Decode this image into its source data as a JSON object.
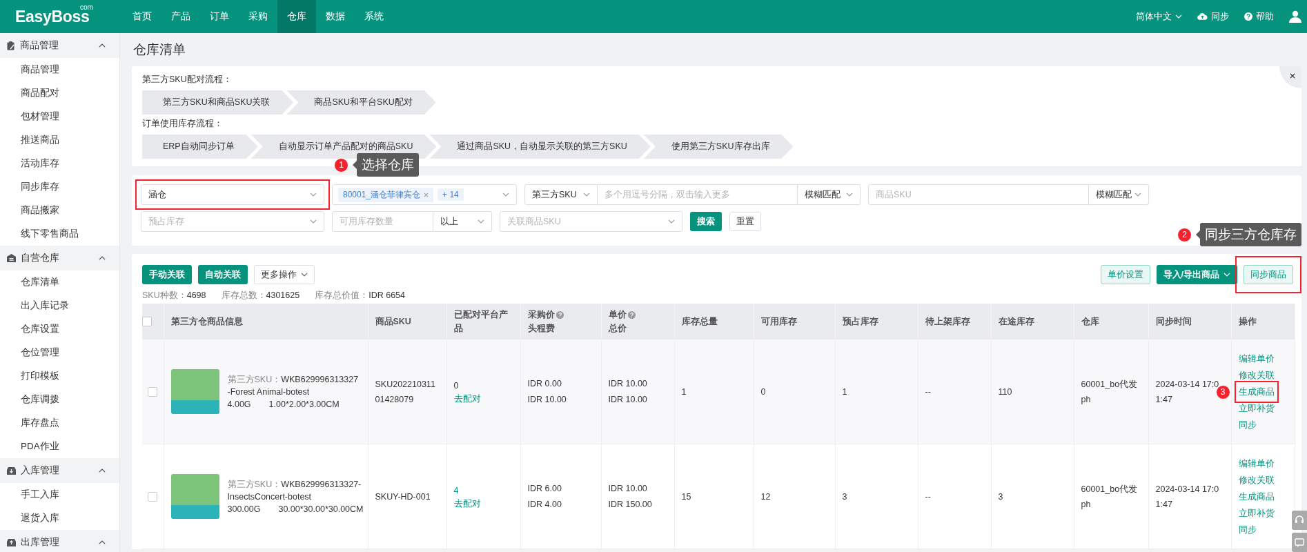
{
  "topbar": {
    "logo": "EasyBoss",
    "logo_suffix": "com",
    "nav": [
      {
        "label": "首页",
        "selected": false
      },
      {
        "label": "产品",
        "selected": false
      },
      {
        "label": "订单",
        "selected": false
      },
      {
        "label": "采购",
        "selected": false
      },
      {
        "label": "仓库",
        "selected": true
      },
      {
        "label": "数据",
        "selected": false
      },
      {
        "label": "系统",
        "selected": false
      }
    ],
    "language": "简体中文",
    "sync": "同步",
    "help": "帮助"
  },
  "sidebar": {
    "groups": [
      {
        "title": "商品管理",
        "kind": "goods",
        "expanded": true,
        "items": [
          "商品管理",
          "商品配对",
          "包材管理",
          "推送商品",
          "活动库存",
          "同步库存",
          "商品搬家",
          "线下零售商品"
        ]
      },
      {
        "title": "自营仓库",
        "kind": "warehouse",
        "expanded": true,
        "items": [
          "仓库清单",
          "出入库记录",
          "仓库设置",
          "仓位管理",
          "打印模板",
          "仓库调拨",
          "库存盘点",
          "PDA作业"
        ]
      },
      {
        "title": "入库管理",
        "kind": "inbound",
        "expanded": true,
        "items": [
          "手工入库",
          "退货入库"
        ]
      },
      {
        "title": "出库管理",
        "kind": "outbound",
        "expanded": true
      }
    ]
  },
  "page_title": "仓库清单",
  "flow": {
    "sections": [
      {
        "label": "第三方SKU配对流程：",
        "steps": [
          "第三方SKU和商品SKU关联",
          "商品SKU和平台SKU配对"
        ]
      },
      {
        "label": "订单使用库存流程：",
        "steps": [
          "ERP自动同步订单",
          "自动显示订单产品配对的商品SKU",
          "通过商品SKU，自动显示关联的第三方SKU",
          "使用第三方SKU库存出库"
        ]
      }
    ]
  },
  "filters": {
    "warehouse": {
      "value": "涵仓",
      "highlighted": true,
      "annotation": {
        "number": "1",
        "text": "选择仓库"
      }
    },
    "warehouse_tags": {
      "tags": [
        "80001_涵仓菲律宾仓"
      ],
      "more": "+ 14"
    },
    "sku_type": "第三方SKU",
    "sku_input": {
      "placeholder": "多个用逗号分隔，双击输入更多"
    },
    "sku_match": "模糊匹配",
    "product_sku": {
      "placeholder": "商品SKU"
    },
    "product_match": "模糊匹配",
    "reserved": {
      "placeholder": "预占库存"
    },
    "available_qty": {
      "placeholder": "可用库存数量"
    },
    "qty_compare": "以上",
    "linked_sku": {
      "placeholder": "关联商品SKU"
    },
    "search": "搜索",
    "reset": "重置"
  },
  "toolbar": {
    "left": [
      {
        "label": "手动关联",
        "kind": "primary",
        "highlighted": false
      },
      {
        "label": "自动关联",
        "kind": "primary",
        "highlighted": false
      },
      {
        "label": "更多操作",
        "kind": "dropdown",
        "highlighted": false
      }
    ],
    "right": [
      {
        "label": "单价设置",
        "kind": "light",
        "highlighted": false
      },
      {
        "label": "导入/导出商品",
        "kind": "primary-dropdown",
        "highlighted": false
      },
      {
        "label": "同步商品",
        "kind": "light",
        "highlighted": true,
        "annotation": {
          "number": "2",
          "text": "同步三方仓库存"
        }
      }
    ]
  },
  "stats": [
    {
      "label": "SKU种数：",
      "value": "4698"
    },
    {
      "label": "库存总数：",
      "value": "4301625"
    },
    {
      "label": "库存总价值：",
      "value": "IDR 6654"
    }
  ],
  "table": {
    "all_checked": false,
    "columns": [
      {
        "lines": [
          "第三方仓商品信息"
        ],
        "help": false
      },
      {
        "lines": [
          "商品SKU"
        ],
        "help": false
      },
      {
        "lines": [
          "已配对平台产品"
        ],
        "help": false
      },
      {
        "lines": [
          "采购价",
          "头程费"
        ],
        "help": true
      },
      {
        "lines": [
          "单价",
          "总价"
        ],
        "help": true
      },
      {
        "lines": [
          "库存总量"
        ],
        "help": false
      },
      {
        "lines": [
          "可用库存"
        ],
        "help": false
      },
      {
        "lines": [
          "预占库存"
        ],
        "help": false
      },
      {
        "lines": [
          "待上架库存"
        ],
        "help": false
      },
      {
        "lines": [
          "在途库存"
        ],
        "help": false
      },
      {
        "lines": [
          "仓库"
        ],
        "help": false
      },
      {
        "lines": [
          "同步时间"
        ],
        "help": false
      },
      {
        "lines": [
          "操作"
        ],
        "help": false
      }
    ],
    "rows": [
      {
        "checked": false,
        "sku_label": "第三方SKU：",
        "sku": "WKB629996313327-Forest Animal-botest",
        "weight": "4.00G",
        "size": "1.00*2.00*3.00CM",
        "product_sku": "SKU20221031101428079",
        "matched_count": "0",
        "has_matches": false,
        "match_link": "去配对",
        "purchase_price": "IDR 0.00",
        "first_leg_fee": "IDR 10.00",
        "unit_price": "IDR 10.00",
        "total_price": "IDR 10.00",
        "total_stock": "1",
        "available": "0",
        "reserved": "1",
        "pending_shelf": "--",
        "in_transit": "110",
        "warehouse": "60001_bo代发ph",
        "sync_time": "2024-03-14 17:01:47",
        "actions": [
          {
            "label": "编辑单价",
            "highlighted": false
          },
          {
            "label": "修改关联",
            "highlighted": false
          },
          {
            "label": "生成商品",
            "highlighted": true,
            "annotation": {
              "number": "3"
            }
          },
          {
            "label": "立即补货",
            "highlighted": false
          },
          {
            "label": "同步",
            "highlighted": false
          }
        ]
      },
      {
        "checked": false,
        "sku_label": "第三方SKU：",
        "sku": "WKB629996313327-InsectsConcert-botest",
        "weight": "300.00G",
        "size": "30.00*30.00*30.00CM",
        "product_sku": "SKUY-HD-001",
        "matched_count": "4",
        "has_matches": true,
        "match_link": "去配对",
        "purchase_price": "IDR 6.00",
        "first_leg_fee": "IDR 4.00",
        "unit_price": "IDR 10.00",
        "total_price": "IDR 150.00",
        "total_stock": "15",
        "available": "12",
        "reserved": "3",
        "pending_shelf": "--",
        "in_transit": "3",
        "warehouse": "60001_bo代发ph",
        "sync_time": "2024-03-14 17:01:47",
        "actions": [
          {
            "label": "编辑单价",
            "highlighted": false
          },
          {
            "label": "修改关联",
            "highlighted": false
          },
          {
            "label": "生成商品",
            "highlighted": false
          },
          {
            "label": "立即补货",
            "highlighted": false
          },
          {
            "label": "同步",
            "highlighted": false
          }
        ]
      }
    ]
  }
}
